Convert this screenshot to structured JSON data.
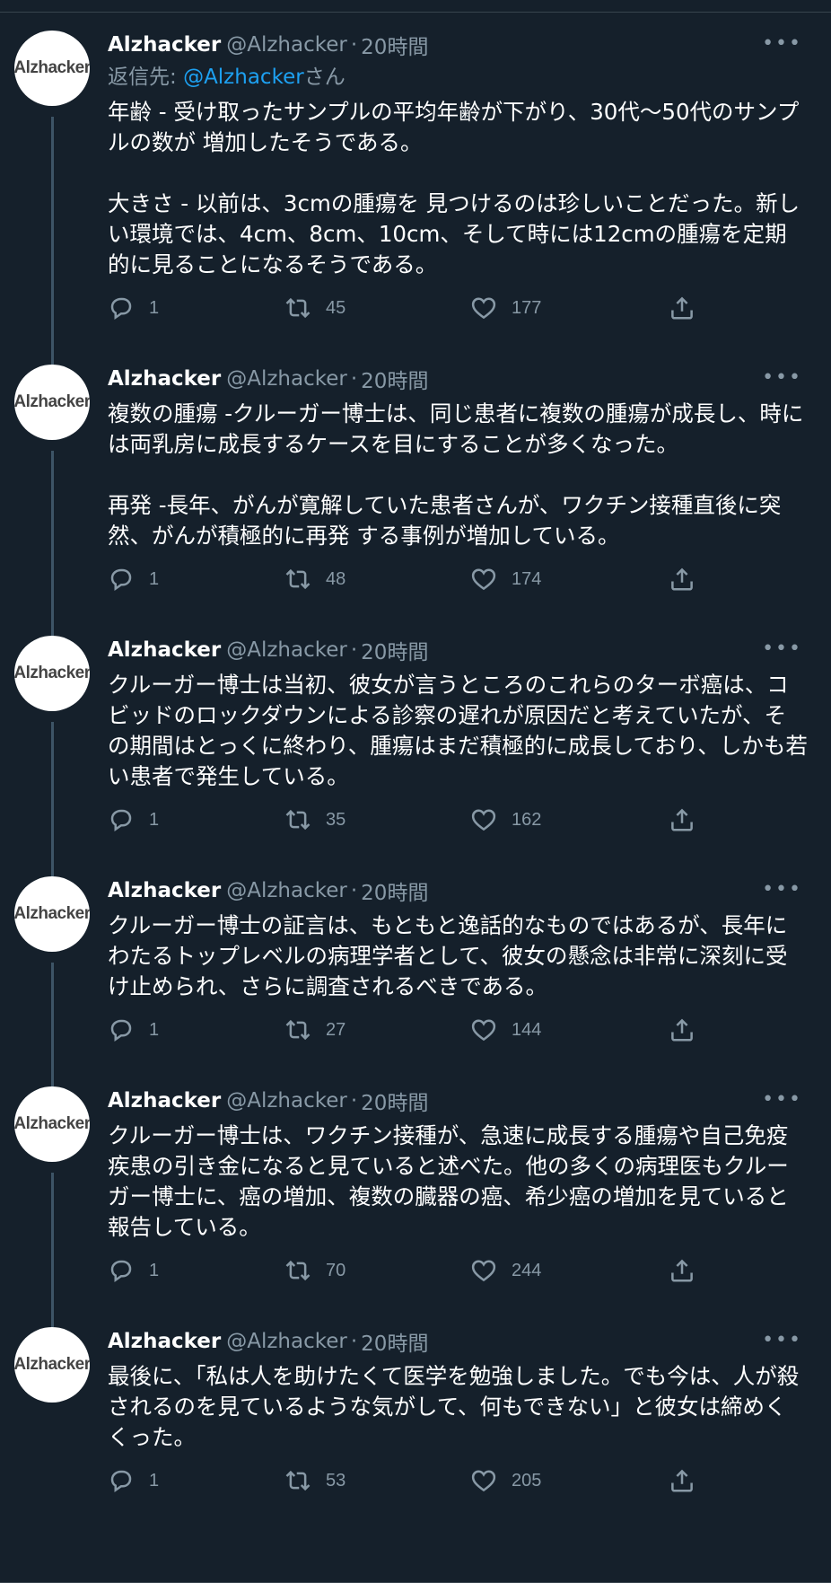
{
  "tweets": [
    {
      "name": "Alzhacker",
      "handle": "@Alzhacker",
      "time": "20時間",
      "reply_prefix": "返信先: ",
      "reply_mention": "@Alzhacker",
      "reply_suffix": "さん",
      "text": "年齢 - 受け取ったサンプルの平均年齢が下がり、30代～50代のサンプルの数が 増加したそうである。\n\n大きさ - 以前は、3cmの腫瘍を 見つけるのは珍しいことだった。新しい環境では、4cm、8cm、10cm、そして時には12cmの腫瘍を定期的に見ることになるそうである。",
      "replies": "1",
      "retweets": "45",
      "likes": "177"
    },
    {
      "name": "Alzhacker",
      "handle": "@Alzhacker",
      "time": "20時間",
      "text": "複数の腫瘍 -クルーガー博士は、同じ患者に複数の腫瘍が成長し、時には両乳房に成長するケースを目にすることが多くなった。\n\n再発 -長年、がんが寛解していた患者さんが、ワクチン接種直後に突然、がんが積極的に再発 する事例が増加している。",
      "replies": "1",
      "retweets": "48",
      "likes": "174"
    },
    {
      "name": "Alzhacker",
      "handle": "@Alzhacker",
      "time": "20時間",
      "text": "クルーガー博士は当初、彼女が言うところのこれらのターボ癌は、コビッドのロックダウンによる診察の遅れが原因だと考えていたが、その期間はとっくに終わり、腫瘍はまだ積極的に成長しており、しかも若い患者で発生している。",
      "replies": "1",
      "retweets": "35",
      "likes": "162"
    },
    {
      "name": "Alzhacker",
      "handle": "@Alzhacker",
      "time": "20時間",
      "text": "クルーガー博士の証言は、もともと逸話的なものではあるが、長年にわたるトップレベルの病理学者として、彼女の懸念は非常に深刻に受け止められ、さらに調査されるべきである。",
      "replies": "1",
      "retweets": "27",
      "likes": "144"
    },
    {
      "name": "Alzhacker",
      "handle": "@Alzhacker",
      "time": "20時間",
      "text": "クルーガー博士は、ワクチン接種が、急速に成長する腫瘍や自己免疫疾患の引き金になると見ていると述べた。他の多くの病理医もクルーガー博士に、癌の増加、複数の臓器の癌、希少癌の増加を見ていると報告している。",
      "replies": "1",
      "retweets": "70",
      "likes": "244"
    },
    {
      "name": "Alzhacker",
      "handle": "@Alzhacker",
      "time": "20時間",
      "text": "最後に、「私は人を助けたくて医学を勉強しました。でも今は、人が殺されるのを見ているような気がして、何もできない」と彼女は締めくくった。",
      "replies": "1",
      "retweets": "53",
      "likes": "205"
    }
  ],
  "avatar_text": "Alzhacker",
  "dot": "·",
  "more_glyph": "•••",
  "icons": {
    "reply": "reply-icon",
    "retweet": "retweet-icon",
    "like": "heart-icon",
    "share": "share-icon",
    "more": "more-icon"
  },
  "colors": {
    "background": "#15202b",
    "secondary_text": "#8899a6",
    "mention": "#1da1f2",
    "thread_line": "#3d5466",
    "divider": "#38444d"
  }
}
